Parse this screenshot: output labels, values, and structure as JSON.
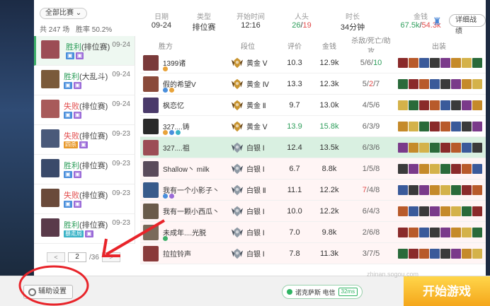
{
  "filter": {
    "label": "全部比赛 ⌄"
  },
  "summary": {
    "total": "共 247 场",
    "winrate": "胜率 50.2%"
  },
  "header": {
    "labels": {
      "date": "日期",
      "type": "类型",
      "start": "开始时间",
      "players": "人头",
      "duration": "时长",
      "gold": "金钱"
    },
    "values": {
      "date": "09-24",
      "type": "排位赛",
      "start": "12:16",
      "kills_own": "26",
      "kills_sep": "/",
      "kills_enemy": "19",
      "duration": "34分钟",
      "gold_own": "67.5k",
      "gold_sep": "/",
      "gold_enemy": "54.3k"
    },
    "detail_button": "详细战绩"
  },
  "match_list": [
    {
      "result": "胜利",
      "result_type": "win",
      "mode": "(排位赛)",
      "date": "09-24",
      "tags": [
        "▣",
        "▣"
      ],
      "tag_colors": [
        "blue",
        "purple"
      ],
      "avatar": "#9c4d55"
    },
    {
      "result": "胜利",
      "result_type": "win",
      "mode": "(大乱斗)",
      "date": "09-24",
      "tags": [
        "▣",
        "▣"
      ],
      "tag_colors": [
        "blue",
        "purple"
      ],
      "avatar": "#7a5a3a"
    },
    {
      "result": "失败",
      "result_type": "lose",
      "mode": "(排位赛)",
      "date": "09-24",
      "tags": [
        "▣",
        "▣"
      ],
      "tag_colors": [
        "blue",
        "purple"
      ],
      "avatar": "#a85a5a"
    },
    {
      "result": "失败",
      "result_type": "lose",
      "mode": "(排位赛)",
      "date": "09-23",
      "tags": [
        "四杀",
        "▣"
      ],
      "tag_colors": [
        "orange",
        "purple"
      ],
      "avatar": "#4a5a7a"
    },
    {
      "result": "胜利",
      "result_type": "win",
      "mode": "(排位赛)",
      "date": "09-23",
      "tags": [
        "▣",
        "▣"
      ],
      "tag_colors": [
        "blue",
        "purple"
      ],
      "avatar": "#3a4a6a"
    },
    {
      "result": "失败",
      "result_type": "lose",
      "mode": "(排位赛)",
      "date": "09-23",
      "tags": [
        "▣",
        "▣"
      ],
      "tag_colors": [
        "blue",
        "purple"
      ],
      "avatar": "#6a4a3a"
    },
    {
      "result": "胜利",
      "result_type": "win",
      "mode": "(排位赛)",
      "date": "09-23",
      "tags": [
        "暴走局",
        "▣"
      ],
      "tag_colors": [
        "teal",
        "purple"
      ],
      "avatar": "#5a3a4a"
    }
  ],
  "pager": {
    "prev": "<",
    "page": "2",
    "total": "/36",
    "next": ">"
  },
  "table_headers": {
    "player": "胜方",
    "rank": "段位",
    "score": "评价",
    "gold": "金钱",
    "kda": "杀敌/死亡/助攻",
    "items": "出装"
  },
  "players": [
    {
      "name": "1399诸",
      "rank": "黄金 Ⅴ",
      "tier": "gold",
      "score": "10.3",
      "gold": "12.9k",
      "k": "5",
      "d": "6",
      "a": "10",
      "a_color": "green",
      "team": "win",
      "avatar": "#7a3a3a",
      "badges": [
        "#e8a33a"
      ]
    },
    {
      "name": "假的希望V",
      "rank": "黄金 Ⅳ",
      "tier": "gold",
      "score": "13.3",
      "gold": "12.3k",
      "k": "5",
      "d": "2",
      "a": "7",
      "d_color": "red",
      "team": "win",
      "avatar": "#8a4a3a",
      "badges": [
        "#4a8fdc",
        "#e8a33a"
      ]
    },
    {
      "name": "枫恋忆",
      "rank": "黄金 Ⅱ",
      "tier": "gold",
      "score": "9.7",
      "gold": "13.0k",
      "k": "4",
      "d": "5",
      "a": "6",
      "team": "win",
      "avatar": "#4a3a6a",
      "badges": []
    },
    {
      "name": "327....铸",
      "rank": "黄金 Ⅴ",
      "tier": "gold",
      "score": "13.9",
      "gold": "15.8k",
      "k": "6",
      "d": "3",
      "a": "9",
      "score_color": "green",
      "gold_color": "green",
      "team": "win",
      "avatar": "#2a2a2a",
      "badges": [
        "#e8a33a",
        "#4a8fdc",
        "#3ab3c7"
      ]
    },
    {
      "name": "327....祖",
      "rank": "白银 Ⅰ",
      "tier": "silver",
      "score": "12.4",
      "gold": "13.5k",
      "k": "6",
      "d": "3",
      "a": "6",
      "team": "self",
      "avatar": "#9c4d55",
      "badges": []
    },
    {
      "name": "Shallow丶 milk",
      "rank": "白银 Ⅰ",
      "tier": "silver",
      "score": "6.7",
      "gold": "8.8k",
      "k": "1",
      "d": "5",
      "a": "8",
      "team": "lose",
      "avatar": "#5a4a5a",
      "badges": []
    },
    {
      "name": "我有一个小影子丶",
      "rank": "白银 Ⅱ",
      "tier": "silver",
      "score": "11.1",
      "gold": "12.2k",
      "k": "7",
      "d": "4",
      "a": "8",
      "k_color": "red",
      "team": "lose",
      "avatar": "#3a5a8a",
      "badges": [
        "#4a8fdc",
        "#9a6ad8"
      ]
    },
    {
      "name": "我有一颗小西瓜丶",
      "rank": "白银 Ⅰ",
      "tier": "silver",
      "score": "10.0",
      "gold": "12.2k",
      "k": "6",
      "d": "4",
      "a": "3",
      "team": "lose",
      "avatar": "#6a5a4a",
      "badges": []
    },
    {
      "name": "未成年....光脱",
      "rank": "白银 Ⅰ",
      "tier": "silver",
      "score": "7.0",
      "gold": "9.8k",
      "k": "2",
      "d": "6",
      "a": "8",
      "team": "lose",
      "avatar": "#7a6a5a",
      "badges": [
        "#3fb06a"
      ]
    },
    {
      "name": "拉拉铃声",
      "rank": "白银 Ⅰ",
      "tier": "silver",
      "score": "7.8",
      "gold": "11.3k",
      "k": "3",
      "d": "7",
      "a": "5",
      "team": "lose",
      "avatar": "#8a3a3a",
      "badges": []
    }
  ],
  "item_palette": [
    "#8a2a2a",
    "#c58a2a",
    "#3a5a9a",
    "#2a6a3a",
    "#7a3a8a",
    "#b85a2a",
    "#d4b24a",
    "#3a3a3a"
  ],
  "bottom": {
    "settings": "辅助设置",
    "server": "诺克萨斯 电信",
    "ping": "32ms",
    "start": "开始游戏"
  },
  "watermark": "zhinan.sogou.com"
}
